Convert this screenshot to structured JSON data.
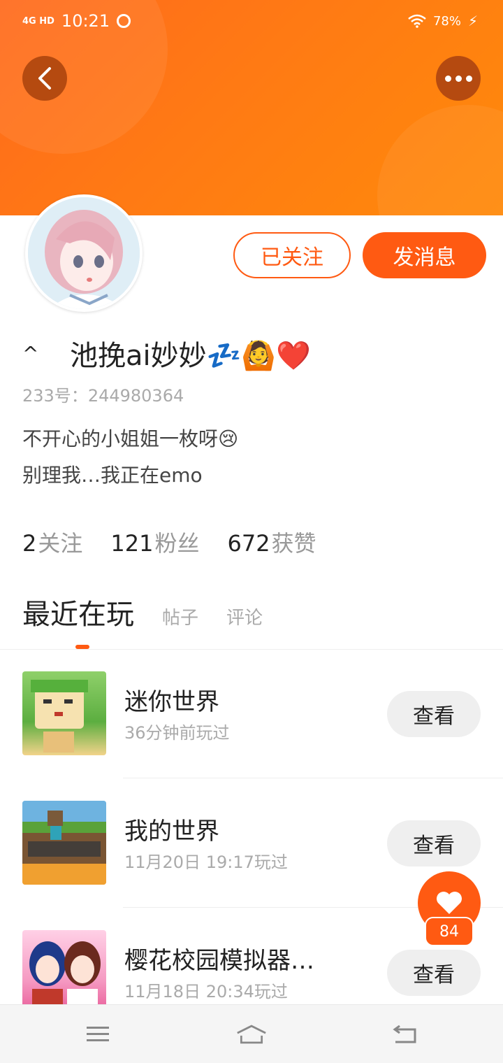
{
  "status_bar": {
    "network": "4G HD",
    "time": "10:21",
    "battery": "78%"
  },
  "profile": {
    "nickname": "池挽ai妙妙💤🙆❤️",
    "uid_label": "233号：",
    "uid": "244980364",
    "bio_line1": "不开心的小姐姐一枚呀😢",
    "bio_line2": "别理我…我正在emo",
    "follow_state_label": "已关注",
    "message_label": "发消息"
  },
  "stats": [
    {
      "value": "2",
      "label": "关注"
    },
    {
      "value": "121",
      "label": "粉丝"
    },
    {
      "value": "672",
      "label": "获赞"
    }
  ],
  "tabs": [
    {
      "label": "最近在玩",
      "active": true
    },
    {
      "label": "帖子",
      "active": false
    },
    {
      "label": "评论",
      "active": false
    }
  ],
  "games": [
    {
      "name": "迷你世界",
      "played": "36分钟前玩过",
      "action": "查看",
      "icon": "mini-world-icon"
    },
    {
      "name": "我的世界",
      "played": "11月20日  19:17玩过",
      "action": "查看",
      "icon": "minecraft-icon"
    },
    {
      "name": "樱花校园模拟器…",
      "played": "11月18日  20:34玩过",
      "action": "查看",
      "icon": "sakura-school-icon"
    }
  ],
  "like_count": "84",
  "colors": {
    "accent": "#ff5a12",
    "banner": "#ff7a14"
  }
}
